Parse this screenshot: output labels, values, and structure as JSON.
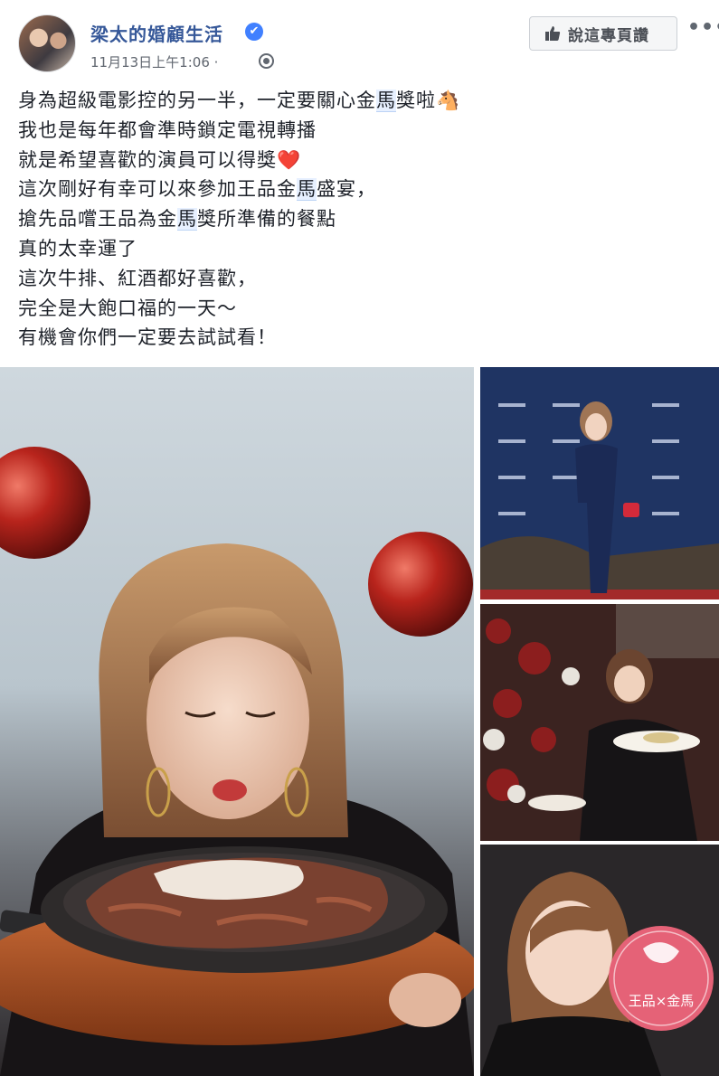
{
  "header": {
    "page_name": "梁太的婚顧生活",
    "verified_mark": "✔",
    "timestamp": "11月13日上午1:06 · ",
    "like_button_label": "說這專頁讚",
    "more_label": "•••"
  },
  "post": {
    "lines": [
      [
        "身為超級電影控的另一半，一定要關心金",
        "馬",
        "獎啦🐴"
      ],
      [
        "我也是每年都會準時鎖定電視轉播",
        "",
        ""
      ],
      [
        "就是希望喜歡的演員可以得獎❤️",
        "",
        ""
      ],
      [
        "這次剛好有幸可以來參加王品金",
        "馬",
        "盛宴，"
      ],
      [
        "搶先品嚐王品為金",
        "馬",
        "獎所準備的餐點"
      ],
      [
        "真的太幸運了",
        "",
        ""
      ],
      [
        "這次牛排、紅酒都好喜歡，",
        "",
        ""
      ],
      [
        "完全是大飽口福的一天～",
        "",
        ""
      ],
      [
        "有機會你們一定要去試試看！",
        "",
        ""
      ]
    ]
  },
  "photos": {
    "badge_text": "王品×金馬"
  }
}
